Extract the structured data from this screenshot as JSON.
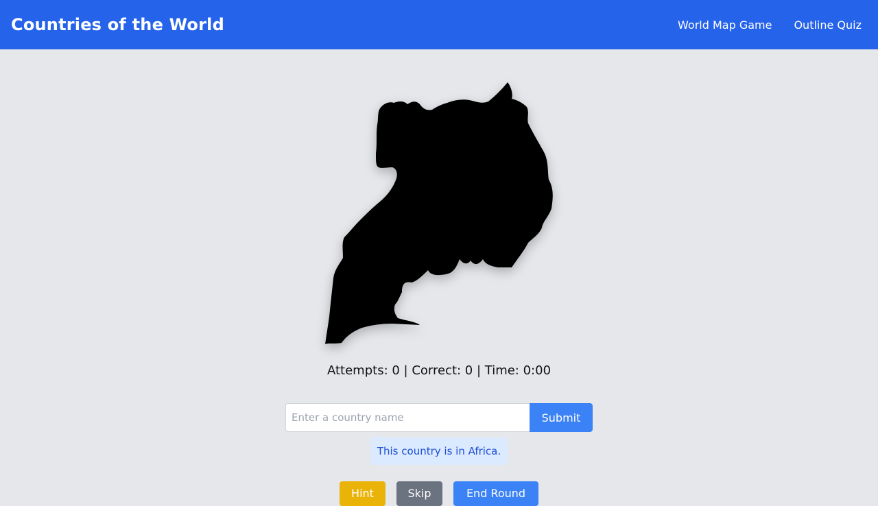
{
  "header": {
    "title": "Countries of the World",
    "nav": [
      "World Map Game",
      "Outline Quiz"
    ]
  },
  "quiz": {
    "stats": "Attempts: 0 | Correct: 0 | Time: 0:00",
    "input_placeholder": "Enter a country name",
    "input_value": "",
    "submit_label": "Submit",
    "hint_text": "This country is in Africa.",
    "buttons": {
      "hint": "Hint",
      "skip": "Skip",
      "end_round": "End Round"
    }
  },
  "colors": {
    "navbar": "#2563eb",
    "background": "#e5e7eb",
    "primary_button": "#3b82f6",
    "hint_button": "#eab308",
    "skip_button": "#6b7280",
    "hint_box_bg": "#dbeafe",
    "hint_box_text": "#1d4ed8",
    "outline_fill": "#000000"
  }
}
